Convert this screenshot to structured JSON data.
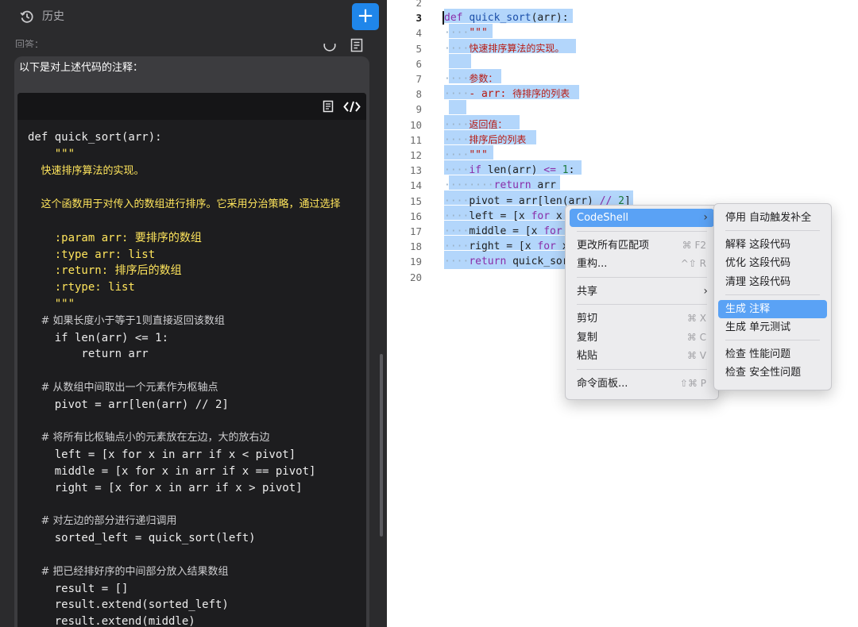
{
  "chat": {
    "header_title": "历史",
    "reply_label": "回答：",
    "intro_text": "以下是对上述代码的注释：",
    "code_lines": [
      {
        "t": "def quick_sort(arr):",
        "k": "code"
      },
      {
        "t": "    \"\"\"",
        "k": "doc"
      },
      {
        "t": "    快速排序算法的实现。",
        "k": "docz"
      },
      {
        "t": "",
        "k": "code"
      },
      {
        "t": "    这个函数用于对传入的数组进行排序。它采用分治策略，通过选择",
        "k": "docz"
      },
      {
        "t": "",
        "k": "code"
      },
      {
        "t": "    :param arr: 要排序的数组",
        "k": "doc"
      },
      {
        "t": "    :type arr: list",
        "k": "doc"
      },
      {
        "t": "    :return: 排序后的数组",
        "k": "doc"
      },
      {
        "t": "    :rtype: list",
        "k": "doc"
      },
      {
        "t": "    \"\"\"",
        "k": "doc"
      },
      {
        "t": "    # 如果长度小于等于1则直接返回该数组",
        "k": "c"
      },
      {
        "t": "    if len(arr) <= 1:",
        "k": "code"
      },
      {
        "t": "        return arr",
        "k": "code"
      },
      {
        "t": "",
        "k": "code"
      },
      {
        "t": "    # 从数组中间取出一个元素作为枢轴点",
        "k": "c"
      },
      {
        "t": "    pivot = arr[len(arr) // 2]",
        "k": "code"
      },
      {
        "t": "",
        "k": "code"
      },
      {
        "t": "    # 将所有比枢轴点小的元素放在左边，大的放右边",
        "k": "c"
      },
      {
        "t": "    left = [x for x in arr if x < pivot]",
        "k": "code"
      },
      {
        "t": "    middle = [x for x in arr if x == pivot]",
        "k": "code"
      },
      {
        "t": "    right = [x for x in arr if x > pivot]",
        "k": "code"
      },
      {
        "t": "",
        "k": "code"
      },
      {
        "t": "    # 对左边的部分进行递归调用",
        "k": "c"
      },
      {
        "t": "    sorted_left = quick_sort(left)",
        "k": "code"
      },
      {
        "t": "",
        "k": "code"
      },
      {
        "t": "    # 把已经排好序的中间部分放入结果数组",
        "k": "c"
      },
      {
        "t": "    result = []",
        "k": "code"
      },
      {
        "t": "    result.extend(sorted_left)",
        "k": "code"
      },
      {
        "t": "    result.extend(middle)",
        "k": "code"
      }
    ]
  },
  "editor": {
    "line_numbers": [
      "2",
      "3",
      "4",
      "5",
      "6",
      "7",
      "8",
      "9",
      "10",
      "11",
      "12",
      "13",
      "14",
      "15",
      "16",
      "17",
      "18",
      "19",
      "20"
    ],
    "current_line": "3",
    "lines": [
      [],
      [
        {
          "t": "def",
          "c": "kw"
        },
        {
          "t": " "
        },
        {
          "t": "quick_sort",
          "c": "fn"
        },
        {
          "t": "(arr):"
        }
      ],
      [
        {
          "t": "····",
          "c": "ws"
        },
        {
          "t": "\"\"\"",
          "c": "str"
        }
      ],
      [
        {
          "t": "····",
          "c": "ws"
        },
        {
          "t": "快速排序算法的实现。",
          "c": "zh"
        }
      ],
      [],
      [
        {
          "t": "····",
          "c": "ws"
        },
        {
          "t": "参数：",
          "c": "zh"
        }
      ],
      [
        {
          "t": "····",
          "c": "ws"
        },
        {
          "t": "- arr: ",
          "c": "str"
        },
        {
          "t": "待排序的列表",
          "c": "zh"
        }
      ],
      [],
      [
        {
          "t": "····",
          "c": "ws"
        },
        {
          "t": "返回值：",
          "c": "zh"
        }
      ],
      [
        {
          "t": "····",
          "c": "ws"
        },
        {
          "t": "排序后的列表",
          "c": "zh"
        }
      ],
      [
        {
          "t": "····",
          "c": "ws"
        },
        {
          "t": "\"\"\"",
          "c": "str"
        }
      ],
      [
        {
          "t": "····",
          "c": "ws"
        },
        {
          "t": "if",
          "c": "kw"
        },
        {
          "t": " len(arr) "
        },
        {
          "t": "<=",
          "c": "kw"
        },
        {
          "t": " "
        },
        {
          "t": "1",
          "c": "num"
        },
        {
          "t": ":"
        }
      ],
      [
        {
          "t": "········",
          "c": "ws"
        },
        {
          "t": "return",
          "c": "kw"
        },
        {
          "t": " arr"
        }
      ],
      [
        {
          "t": "····",
          "c": "ws"
        },
        {
          "t": "pivot = arr[len(arr) "
        },
        {
          "t": "//",
          "c": "kw"
        },
        {
          "t": " "
        },
        {
          "t": "2",
          "c": "num"
        },
        {
          "t": "]"
        }
      ],
      [
        {
          "t": "····",
          "c": "ws"
        },
        {
          "t": "left = [x "
        },
        {
          "t": "for",
          "c": "kw"
        },
        {
          "t": " x"
        }
      ],
      [
        {
          "t": "····",
          "c": "ws"
        },
        {
          "t": "middle = [x "
        },
        {
          "t": "for",
          "c": "kw"
        }
      ],
      [
        {
          "t": "····",
          "c": "ws"
        },
        {
          "t": "right = [x "
        },
        {
          "t": "for",
          "c": "kw"
        },
        {
          "t": " x"
        }
      ],
      [
        {
          "t": "····",
          "c": "ws"
        },
        {
          "t": "return",
          "c": "kw"
        },
        {
          "t": " quick_sor"
        }
      ],
      []
    ]
  },
  "context_menu": {
    "items": [
      {
        "id": "codeshell",
        "label": "CodeShell",
        "submenu": true,
        "highlight": true
      },
      {
        "sep": true
      },
      {
        "id": "change-all",
        "label": "更改所有匹配项",
        "shortcut": "⌘ F2"
      },
      {
        "id": "refactor",
        "label": "重构...",
        "shortcut": "^⇧ R"
      },
      {
        "sep": true
      },
      {
        "id": "share",
        "label": "共享",
        "submenu": true
      },
      {
        "sep": true
      },
      {
        "id": "cut",
        "label": "剪切",
        "shortcut": "⌘ X"
      },
      {
        "id": "copy",
        "label": "复制",
        "shortcut": "⌘ C"
      },
      {
        "id": "paste",
        "label": "粘贴",
        "shortcut": "⌘ V"
      },
      {
        "sep": true
      },
      {
        "id": "command-palette",
        "label": "命令面板...",
        "shortcut": "⇧⌘ P"
      }
    ]
  },
  "codeshell_submenu": {
    "items": [
      {
        "id": "disable-autocomplete",
        "label": "停用 自动触发补全"
      },
      {
        "sep": true
      },
      {
        "id": "explain",
        "label": "解释 这段代码"
      },
      {
        "id": "optimize",
        "label": "优化 这段代码"
      },
      {
        "id": "clean",
        "label": "清理 这段代码"
      },
      {
        "sep": true
      },
      {
        "id": "gen-comment",
        "label": "生成 注释",
        "highlight": true
      },
      {
        "id": "gen-test",
        "label": "生成 单元测试"
      },
      {
        "sep": true
      },
      {
        "id": "check-perf",
        "label": "检查 性能问题"
      },
      {
        "id": "check-security",
        "label": "检查 安全性问题"
      }
    ]
  }
}
